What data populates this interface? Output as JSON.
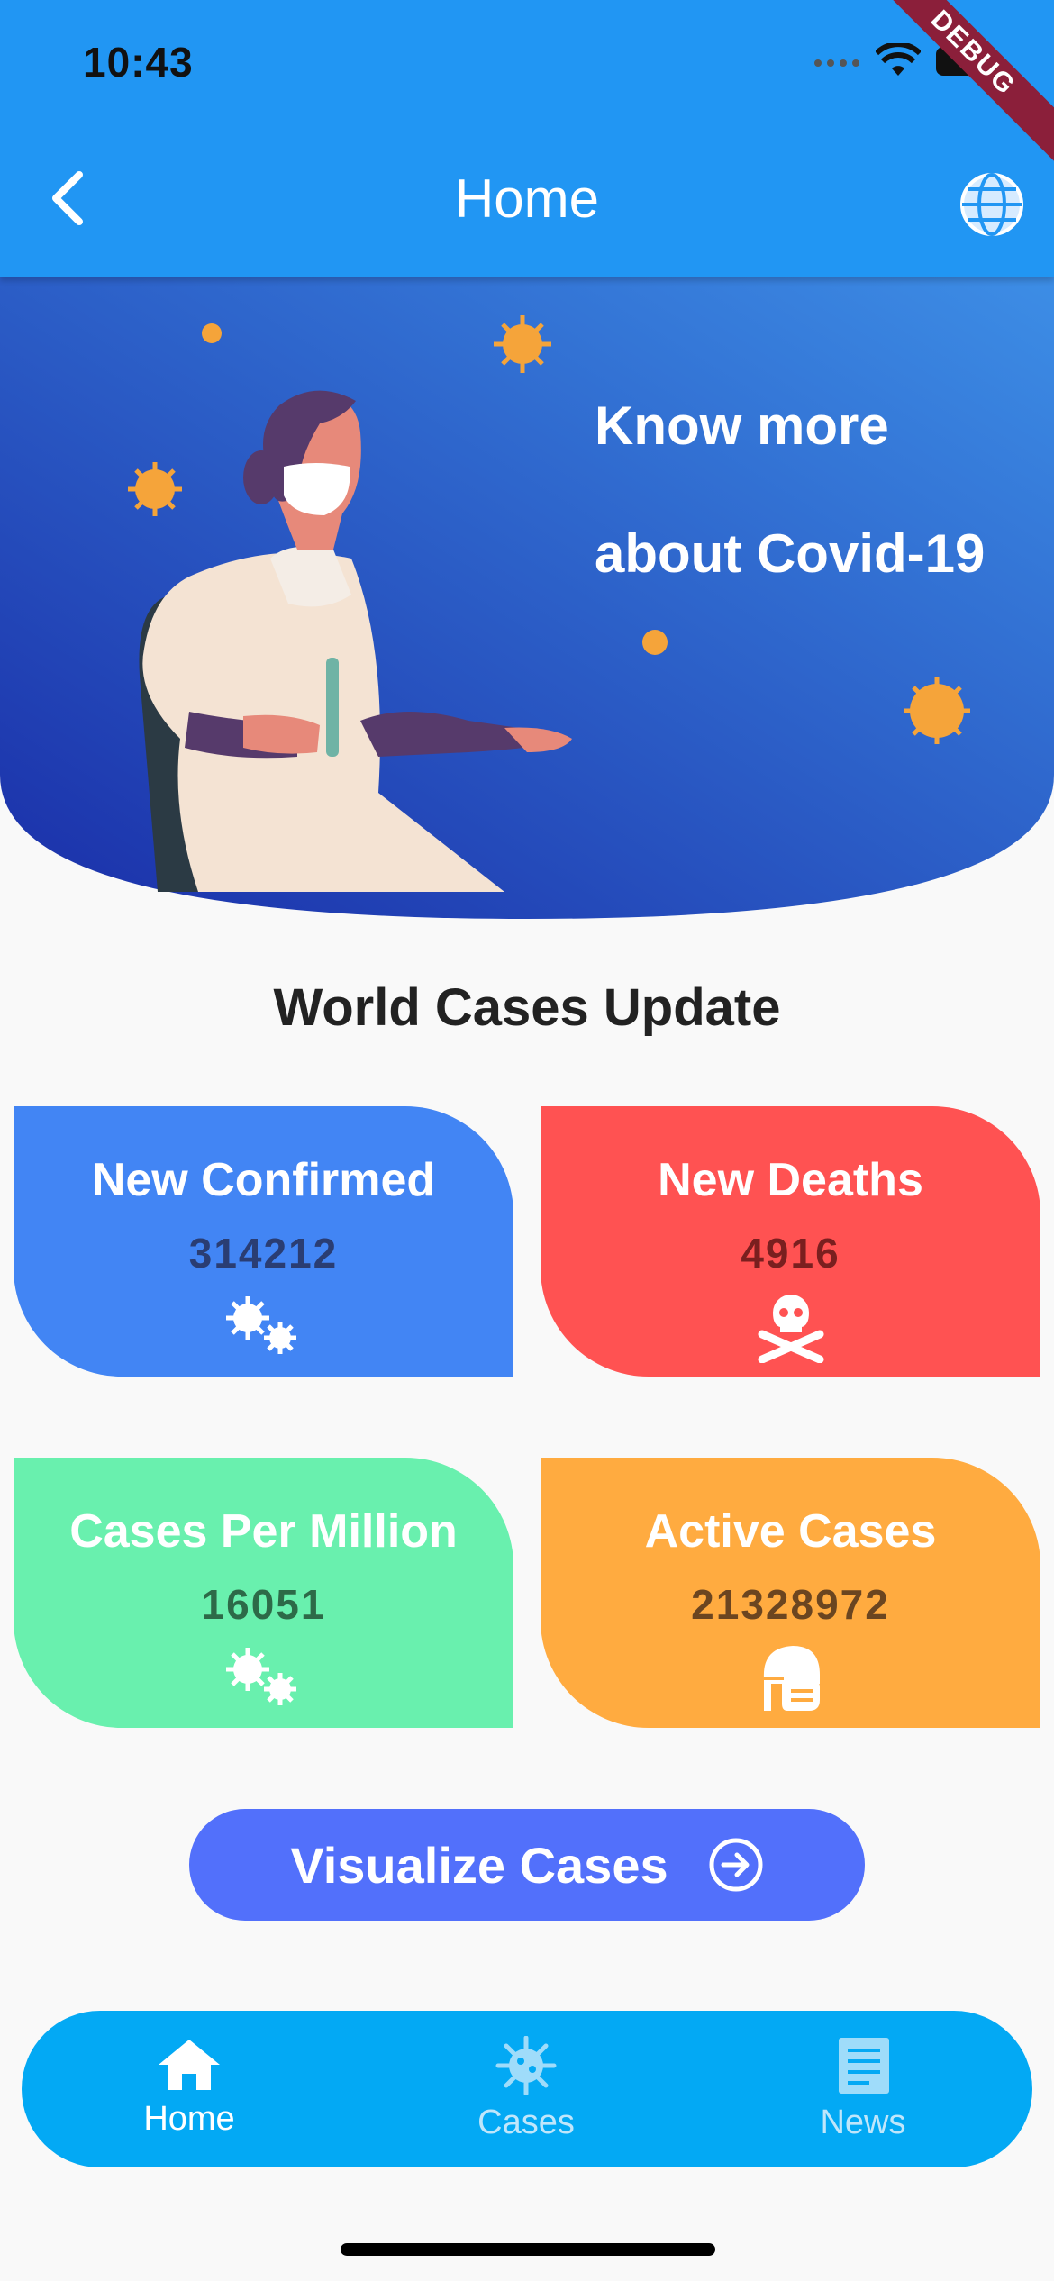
{
  "status_bar": {
    "time": "10:43"
  },
  "debug_banner": "DEBUG",
  "app_bar": {
    "title": "Home"
  },
  "banner": {
    "line1": "Know more",
    "line2": "about Covid-19"
  },
  "section_title": "World Cases Update",
  "cards": [
    {
      "label": "New Confirmed",
      "value": "314212",
      "icon": "virus-cluster-icon",
      "color": "#4285f4",
      "value_color": "#2a3d73"
    },
    {
      "label": "New Deaths",
      "value": "4916",
      "icon": "skull-crossbones-icon",
      "color": "#ff5252",
      "value_color": "#7a1f1f"
    },
    {
      "label": "Cases Per Million",
      "value": "16051",
      "icon": "virus-cluster-icon",
      "color": "#69f0ae",
      "value_color": "#2d6a48"
    },
    {
      "label": "Active Cases",
      "value": "21328972",
      "icon": "masked-head-icon",
      "color": "#ffab40",
      "value_color": "#6b4520"
    }
  ],
  "visualize_button": {
    "label": "Visualize Cases",
    "icon": "arrow-circle-right-icon"
  },
  "bottom_nav": [
    {
      "label": "Home",
      "icon": "home-icon",
      "active": true
    },
    {
      "label": "Cases",
      "icon": "virus-icon",
      "active": false
    },
    {
      "label": "News",
      "icon": "newspaper-icon",
      "active": false
    }
  ],
  "colors": {
    "app_bar": "#2196f3",
    "banner_gradient_start": "#1a2ea8",
    "banner_gradient_end": "#3d8ee6",
    "nav_background": "#03a9f4",
    "visualize_button": "#5270fb"
  }
}
